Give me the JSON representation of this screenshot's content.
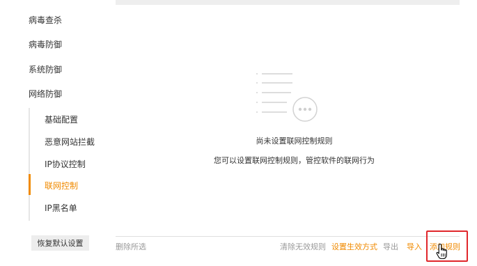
{
  "sidebar": {
    "items": [
      {
        "label": "病毒查杀"
      },
      {
        "label": "病毒防御"
      },
      {
        "label": "系统防御"
      },
      {
        "label": "网络防御"
      }
    ],
    "sub_items": [
      {
        "label": "基础配置"
      },
      {
        "label": "恶意网站拦截"
      },
      {
        "label": "IP协议控制"
      },
      {
        "label": "联网控制",
        "active": true
      },
      {
        "label": "IP黑名单"
      }
    ],
    "restore_button": "恢复默认设置"
  },
  "main": {
    "empty_title": "尚未设置联网控制规则",
    "empty_desc": "您可以设置联网控制规则，管控软件的联网行为"
  },
  "bottom_bar": {
    "delete_selected": "删除所选",
    "clear_invalid": "清除无效规则",
    "set_effective_mode": "设置生效方式",
    "export": "导出",
    "import": "导入",
    "add_rule": "添加规则"
  },
  "colors": {
    "accent": "#f08a00",
    "highlight": "#e0262b",
    "muted": "#999999"
  }
}
